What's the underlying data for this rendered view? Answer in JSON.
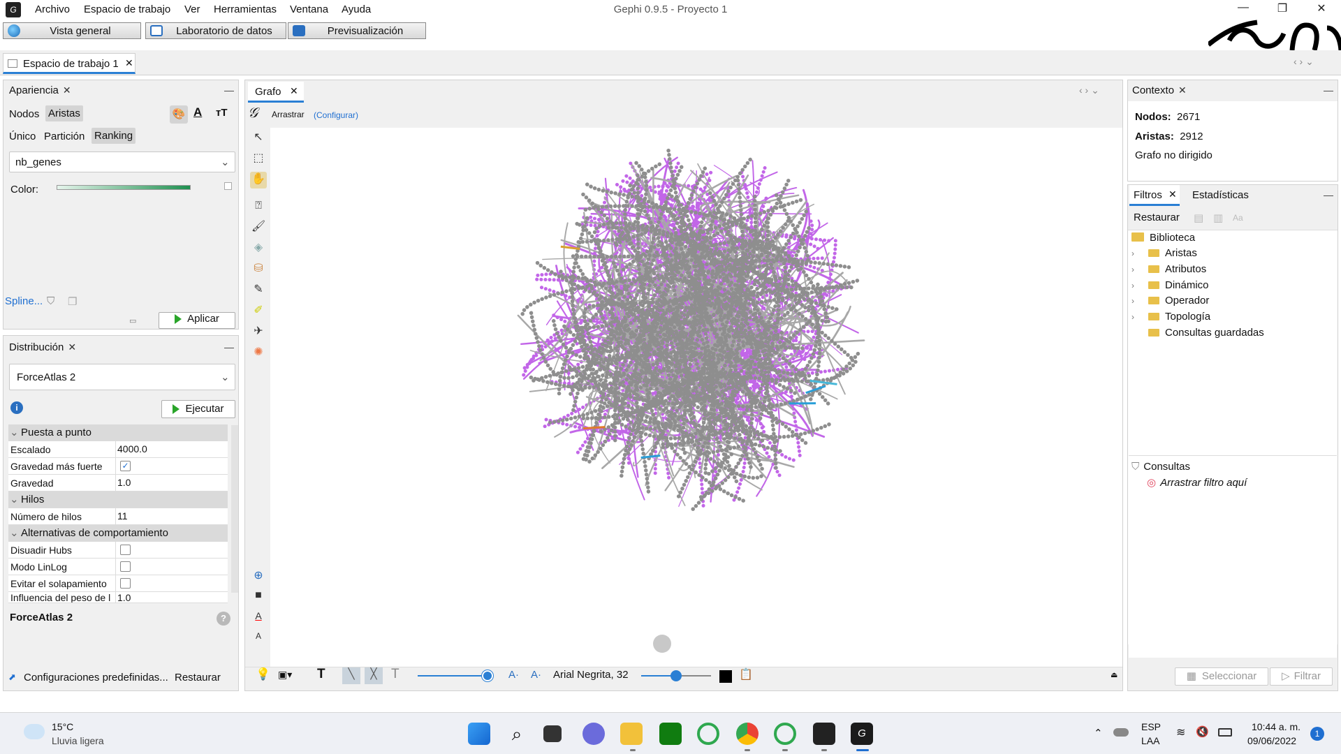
{
  "window": {
    "title": "Gephi 0.9.5 - Proyecto 1"
  },
  "menu": [
    "Archivo",
    "Espacio de trabajo",
    "Ver",
    "Herramientas",
    "Ventana",
    "Ayuda"
  ],
  "modes": [
    "Vista general",
    "Laboratorio de datos",
    "Previsualización"
  ],
  "workspace_tab": "Espacio de trabajo 1",
  "appearance": {
    "title": "Apariencia",
    "tabs": [
      "Nodos",
      "Aristas"
    ],
    "subtabs": [
      "Único",
      "Partición",
      "Ranking"
    ],
    "attribute": "nb_genes",
    "color_label": "Color:",
    "spline_link": "Spline...",
    "apply_label": "Aplicar"
  },
  "layout": {
    "title": "Distribución",
    "algorithm": "ForceAtlas 2",
    "run_label": "Ejecutar",
    "sections": {
      "tuning": "Puesta a punto",
      "threads": "Hilos",
      "behavior": "Alternativas de comportamiento"
    },
    "props": {
      "scaling_label": "Escalado",
      "scaling_value": "4000.0",
      "stronger_gravity_label": "Gravedad más fuerte",
      "gravity_label": "Gravedad",
      "gravity_value": "1.0",
      "threads_label": "Número de hilos",
      "threads_value": "11",
      "dissuade_hubs_label": "Disuadir Hubs",
      "linlog_label": "Modo LinLog",
      "prevent_overlap_label": "Evitar el solapamiento",
      "edge_weight_label": "Influencia del peso de l",
      "edge_weight_value": "1.0"
    },
    "desc_title": "ForceAtlas 2",
    "presets_label": "Configuraciones predefinidas...",
    "reset_label": "Restaurar"
  },
  "graph": {
    "tab": "Grafo",
    "tool_name": "Arrastrar",
    "tool_config": "(Configurar)",
    "font_label": "Arial Negrita, 32"
  },
  "context": {
    "title": "Contexto",
    "nodes_label": "Nodos:",
    "nodes_value": "2671",
    "edges_label": "Aristas:",
    "edges_value": "2912",
    "graph_type": "Grafo no dirigido"
  },
  "filters": {
    "tabs": [
      "Filtros",
      "Estadísticas"
    ],
    "reset_label": "Restaurar",
    "library": "Biblioteca",
    "categories": [
      "Aristas",
      "Atributos",
      "Dinámico",
      "Operador",
      "Topología",
      "Consultas guardadas"
    ],
    "queries_label": "Consultas",
    "drop_hint": "Arrastrar filtro aquí",
    "select_label": "Seleccionar",
    "filter_label": "Filtrar"
  },
  "taskbar": {
    "weather_temp": "15°C",
    "weather_desc": "Lluvia ligera",
    "lang_top": "ESP",
    "lang_bottom": "LAA",
    "time": "10:44 a. m.",
    "date": "09/06/2022",
    "notification_count": "1"
  },
  "colors": {
    "accent": "#1f6fd1",
    "node_gray": "#a8a8a8",
    "edge_purple": "#c266e8"
  }
}
